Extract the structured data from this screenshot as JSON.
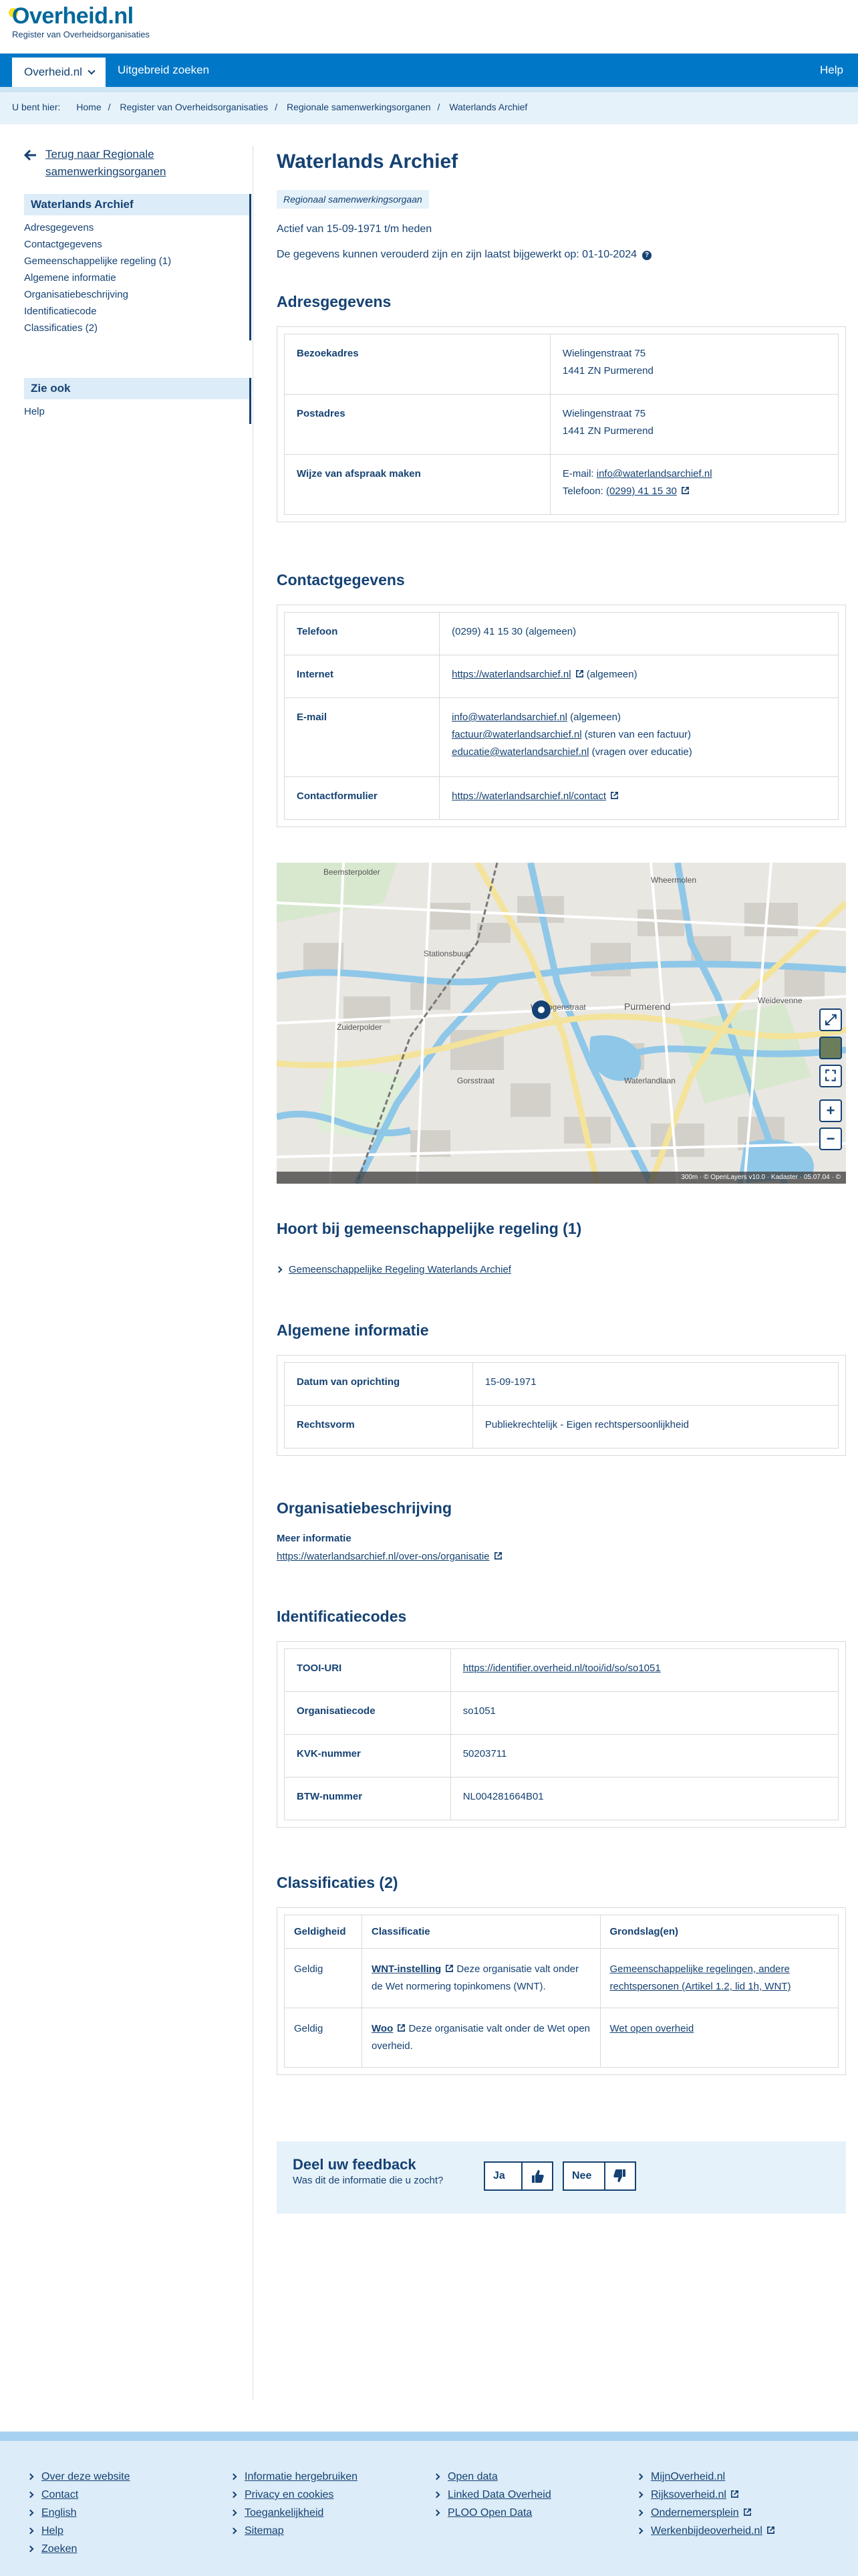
{
  "header": {
    "logo_title": "Overheid.nl",
    "logo_sub": "Register van Overheidsorganisaties"
  },
  "nav": {
    "active": "Overheid.nl",
    "search": "Uitgebreid zoeken",
    "help": "Help"
  },
  "breadcrumb": {
    "prefix": "U bent hier:",
    "items": [
      "Home",
      "Register van Overheidsorganisaties",
      "Regionale samenwerkingsorganen",
      "Waterlands Archief"
    ]
  },
  "sidebar": {
    "back": "Terug naar Regionale samenwerkingsorganen",
    "title": "Waterlands Archief",
    "items": [
      "Adresgegevens",
      "Contactgegevens",
      "Gemeenschappelijke regeling (1)",
      "Algemene informatie",
      "Organisatiebeschrijving",
      "Identificatiecode",
      "Classificaties (2)"
    ],
    "zie_ook_title": "Zie ook",
    "zie_ook_items": [
      "Help"
    ]
  },
  "main": {
    "title": "Waterlands Archief",
    "badge": "Regionaal samenwerkingsorgaan",
    "actief": "Actief van 15-09-1971 t/m heden",
    "bijgewerkt": "De gegevens kunnen verouderd zijn en zijn laatst bijgewerkt op: 01-10-2024"
  },
  "adres": {
    "title": "Adresgegevens",
    "bezoek_label": "Bezoekadres",
    "bezoek_line1": "Wielingenstraat 75",
    "bezoek_line2": "1441 ZN Purmerend",
    "post_label": "Postadres",
    "post_line1": "Wielingenstraat 75",
    "post_line2": "1441 ZN Purmerend",
    "afspraak_label": "Wijze van afspraak maken",
    "afspraak_email_prefix": "E-mail:",
    "afspraak_email": "info@waterlandsarchief.nl",
    "afspraak_tel_prefix": "Telefoon:",
    "afspraak_tel": "(0299) 41 15 30"
  },
  "contact": {
    "title": "Contactgegevens",
    "tel_label": "Telefoon",
    "tel_value": "(0299) 41 15 30 (algemeen)",
    "internet_label": "Internet",
    "internet_link": "https://waterlandsarchief.nl",
    "internet_suffix": "(algemeen)",
    "email_label": "E-mail",
    "email1": "info@waterlandsarchief.nl",
    "email1_suffix": "(algemeen)",
    "email2": "factuur@waterlandsarchief.nl",
    "email2_suffix": "(sturen van een factuur)",
    "email3": "educatie@waterlandsarchief.nl",
    "email3_suffix": "(vragen over educatie)",
    "form_label": "Contactformulier",
    "form_link": "https://waterlandsarchief.nl/contact"
  },
  "map": {
    "labels": [
      "Beemsterpolder",
      "Purmerend",
      "Zuiderpolder",
      "Weidevenne",
      "Gorsstraat",
      "Wielingenstraat",
      "Waterlandlaan",
      "Stationsbuurt",
      "Wheermolen"
    ],
    "attribution": "300m · © OpenLayers v10.0 · Kadaster · 05.07.04 · ©"
  },
  "regeling": {
    "title": "Hoort bij gemeenschappelijke regeling (1)",
    "link": "Gemeenschappelijke Regeling Waterlands Archief"
  },
  "algemeen": {
    "title": "Algemene informatie",
    "datum_label": "Datum van oprichting",
    "datum_value": "15-09-1971",
    "rechtsvorm_label": "Rechtsvorm",
    "rechtsvorm_value": "Publiekrechtelijk - Eigen rechtspersoonlijkheid"
  },
  "beschrijving": {
    "title": "Organisatiebeschrijving",
    "meer_label": "Meer informatie",
    "meer_link": "https://waterlandsarchief.nl/over-ons/organisatie"
  },
  "ident": {
    "title": "Identificatiecodes",
    "tooi_label": "TOOI-URI",
    "tooi_value": "https://identifier.overheid.nl/tooi/id/so/so1051",
    "org_label": "Organisatiecode",
    "org_value": "so1051",
    "kvk_label": "KVK-nummer",
    "kvk_value": "50203711",
    "btw_label": "BTW-nummer",
    "btw_value": "NL004281664B01"
  },
  "classificaties": {
    "title": "Classificaties (2)",
    "headers": [
      "Geldigheid",
      "Classificatie",
      "Grondslag(en)"
    ],
    "row1_geldig": "Geldig",
    "row1_name": "WNT-instelling",
    "row1_desc": "Deze organisatie valt onder de Wet normering topinkomens (WNT).",
    "row1_grondslag": "Gemeenschappelijke regelingen, andere rechtspersonen (Artikel 1.2, lid 1h, WNT)",
    "row2_geldig": "Geldig",
    "row2_name": "Woo",
    "row2_desc": "Deze organisatie valt onder de Wet open overheid.",
    "row2_grondslag": "Wet open overheid"
  },
  "feedback": {
    "title": "Deel uw feedback",
    "question": "Was dit de informatie die u zocht?",
    "yes": "Ja",
    "no": "Nee"
  },
  "footer": {
    "col1": [
      "Over deze website",
      "Contact",
      "English",
      "Help",
      "Zoeken"
    ],
    "col2": [
      "Informatie hergebruiken",
      "Privacy en cookies",
      "Toegankelijkheid",
      "Sitemap"
    ],
    "col3": [
      "Open data",
      "Linked Data Overheid",
      "PLOO Open Data"
    ],
    "col4": [
      "MijnOverheid.nl",
      "Rijksoverheid.nl",
      "Ondernemersplein",
      "Werkenbijdeoverheid.nl"
    ]
  },
  "colors": {
    "primary": "#154273",
    "nav_blue": "#0077c7",
    "light_blue": "#e6f2fa",
    "logo_yellow": "#f9e11e"
  }
}
